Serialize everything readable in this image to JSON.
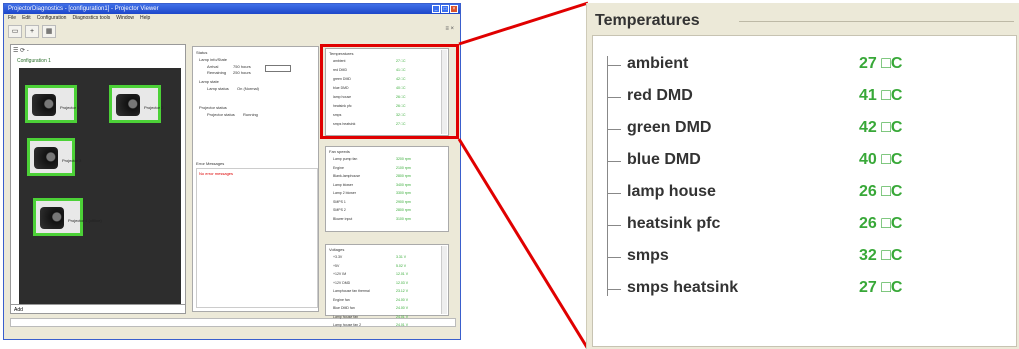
{
  "accent_color": "#e00000",
  "ok_color": "#38a838",
  "app": {
    "title": "ProjectorDiagnostics - [configuration1] - Projector Viewer",
    "window_buttons": [
      "_",
      "□",
      "×"
    ],
    "menu": [
      "File",
      "Edit",
      "Configuration",
      "Diagnostics tools",
      "Window",
      "Help"
    ],
    "toolbar_icons": [
      "open-icon",
      "add-icon",
      "tree-icon"
    ],
    "toolbar_right": "≡ ×",
    "tree_header": "☰ ⟳ -",
    "tree_label": "Configuration 1",
    "projectors": [
      "Projector 1",
      "Projector 2",
      "Projector 3",
      "Projector 4 (offline)"
    ],
    "left_footer": "Add",
    "mid": {
      "status_label": "Status",
      "lamp_info_label": "Lamp info/State",
      "lamp_arrival": "Arrival",
      "lamp_arrival_val": "750 hours",
      "lamp_remaining": "Remaining",
      "lamp_remaining_val": "250 hours",
      "lamp_state_label": "Lamp state",
      "lamp_status": "Lamp status",
      "lamp_status_val": "On (Normal)",
      "proj_status_label": "Projector status",
      "proj_status": "Projector status",
      "proj_status_val": "Running",
      "errors_label": "Error Messages",
      "error_text": "No error messages"
    },
    "fans_label": "Fan speeds",
    "fans": [
      {
        "name": "Lamp pump fan",
        "value": "3200 rpm"
      },
      {
        "name": "Engine",
        "value": "2100 rpm"
      },
      {
        "name": "Blank-lamphouse",
        "value": "2800 rpm"
      },
      {
        "name": "Lamp blower",
        "value": "3400 rpm"
      },
      {
        "name": "Lamp 2 blower",
        "value": "3300 rpm"
      },
      {
        "name": "SMPS 1",
        "value": "2900 rpm"
      },
      {
        "name": "SMPS 2",
        "value": "2800 rpm"
      },
      {
        "name": "Blower input",
        "value": "3100 rpm"
      }
    ],
    "voltages_label": "Voltages",
    "voltages": [
      {
        "name": "+3.3V",
        "value": "3.31 V"
      },
      {
        "name": "+5V",
        "value": "5.02 V"
      },
      {
        "name": "+12V IM",
        "value": "12.01 V"
      },
      {
        "name": "+12V DMD",
        "value": "12.03 V"
      },
      {
        "name": "Lamphouse fan thermal",
        "value": "23.12 V"
      },
      {
        "name": "Engine fan",
        "value": "24.00 V"
      },
      {
        "name": "Blue DMD fan",
        "value": "24.00 V"
      },
      {
        "name": "Lamp house fan",
        "value": "24.01 V"
      },
      {
        "name": "Lamp house fan 2",
        "value": "24.01 V"
      }
    ]
  },
  "temperatures": {
    "title": "Temperatures",
    "items": [
      {
        "label": "ambient",
        "value": "27 □C"
      },
      {
        "label": "red DMD",
        "value": "41 □C"
      },
      {
        "label": "green DMD",
        "value": "42 □C"
      },
      {
        "label": "blue DMD",
        "value": "40 □C"
      },
      {
        "label": "lamp house",
        "value": "26 □C"
      },
      {
        "label": "heatsink pfc",
        "value": "26 □C"
      },
      {
        "label": "smps",
        "value": "32 □C"
      },
      {
        "label": "smps heatsink",
        "value": "27 □C"
      }
    ]
  }
}
